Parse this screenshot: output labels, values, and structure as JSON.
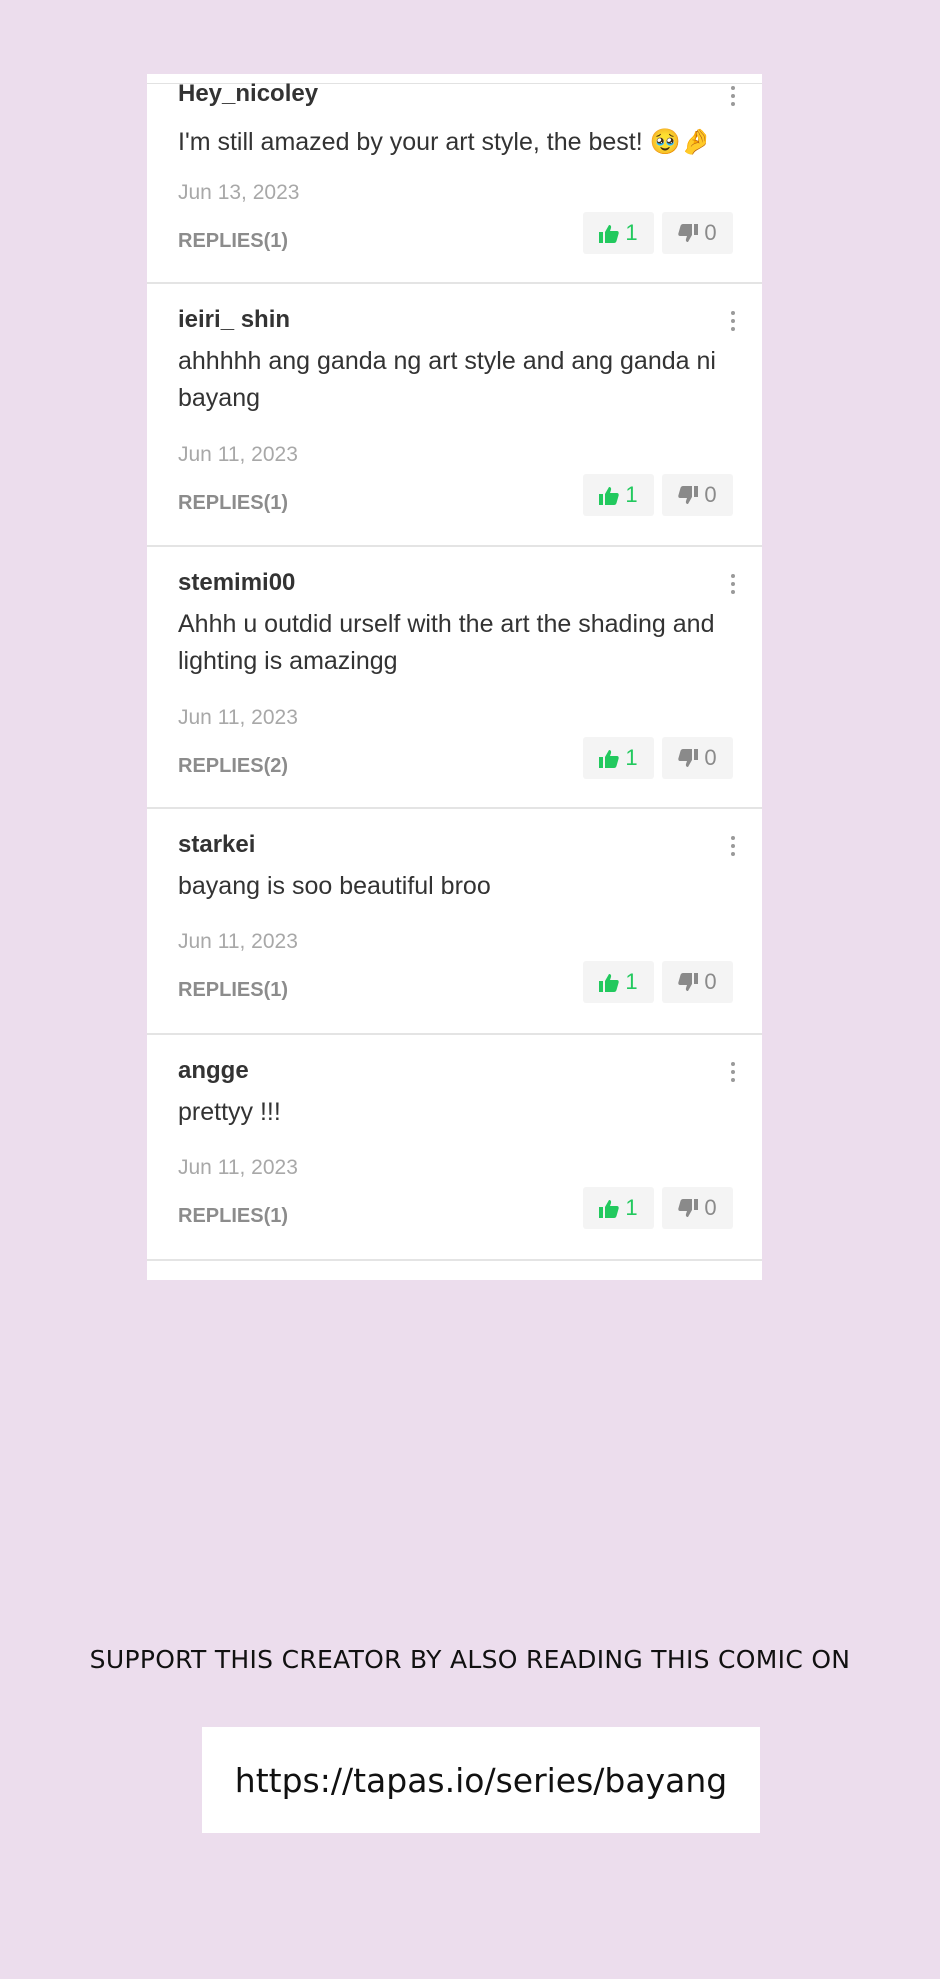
{
  "comments": [
    {
      "username": "Hey_nicoley",
      "text": "I'm still amazed by your art style, the best! 🥹🤌",
      "date": "Jun 13, 2023",
      "replies": "REPLIES(1)",
      "likes": "1",
      "dislikes": "0"
    },
    {
      "username": "ieiri_ shin",
      "text": "ahhhhh ang ganda ng art style and ang ganda ni bayang",
      "date": "Jun 11, 2023",
      "replies": "REPLIES(1)",
      "likes": "1",
      "dislikes": "0"
    },
    {
      "username": "stemimi00",
      "text": "Ahhh u outdid urself with the art the shading and lighting is amazingg",
      "date": "Jun 11, 2023",
      "replies": "REPLIES(2)",
      "likes": "1",
      "dislikes": "0"
    },
    {
      "username": "starkei",
      "text": "bayang is soo beautiful broo",
      "date": "Jun 11, 2023",
      "replies": "REPLIES(1)",
      "likes": "1",
      "dislikes": "0"
    },
    {
      "username": "angge",
      "text": "prettyy !!!",
      "date": "Jun 11, 2023",
      "replies": "REPLIES(1)",
      "likes": "1",
      "dislikes": "0"
    }
  ],
  "icons": {
    "like": "thumbs-up-icon",
    "dislike": "thumbs-down-icon",
    "more": "more-vertical-icon"
  },
  "colors": {
    "background": "#ecdded",
    "like_active": "#22c95e",
    "dislike": "#8a8a8a"
  },
  "support": {
    "message": "SUPPORT THIS CREATOR BY ALSO READING THIS COMIC ON",
    "link": "https://tapas.io/series/bayang"
  }
}
